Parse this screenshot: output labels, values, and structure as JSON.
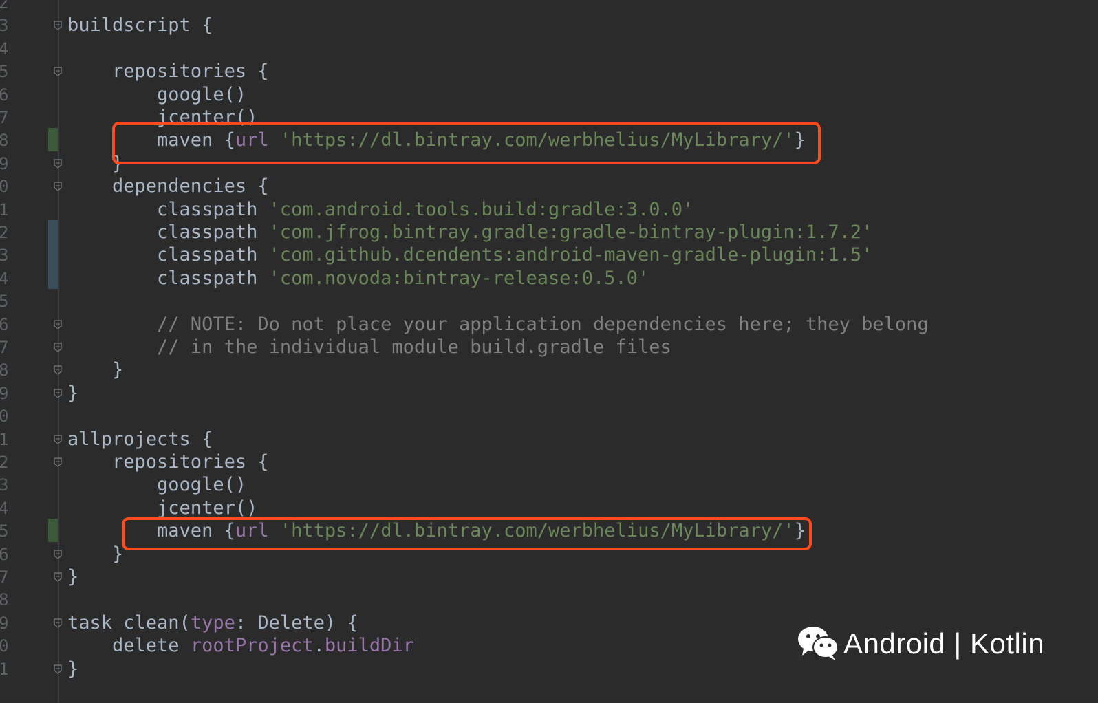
{
  "editor": {
    "lines": [
      {
        "n": "2",
        "code": ""
      },
      {
        "n": "3",
        "code": "buildscript {"
      },
      {
        "n": "4",
        "code": ""
      },
      {
        "n": "5",
        "code": "    repositories {"
      },
      {
        "n": "6",
        "code": "        google()"
      },
      {
        "n": "7",
        "code": "        jcenter()"
      },
      {
        "n": "8",
        "code": "        maven {",
        "prop": "url",
        "str": "'https://dl.bintray.com/werbhelius/MyLibrary/'",
        "tail": "}"
      },
      {
        "n": "9",
        "code": "    }"
      },
      {
        "n": "0",
        "code": "    dependencies {"
      },
      {
        "n": "1",
        "code": "        classpath ",
        "str": "'com.android.tools.build:gradle:3.0.0'"
      },
      {
        "n": "2",
        "code": "        classpath ",
        "str": "'com.jfrog.bintray.gradle:gradle-bintray-plugin:1.7.2'"
      },
      {
        "n": "3",
        "code": "        classpath ",
        "str": "'com.github.dcendents:android-maven-gradle-plugin:1.5'"
      },
      {
        "n": "4",
        "code": "        classpath ",
        "str": "'com.novoda:bintray-release:0.5.0'"
      },
      {
        "n": "5",
        "code": ""
      },
      {
        "n": "6",
        "cmt": "        // NOTE: Do not place your application dependencies here; they belong"
      },
      {
        "n": "7",
        "cmt": "        // in the individual module build.gradle files"
      },
      {
        "n": "8",
        "code": "    }"
      },
      {
        "n": "9",
        "code": "}"
      },
      {
        "n": "0",
        "code": ""
      },
      {
        "n": "1",
        "code": "allprojects {"
      },
      {
        "n": "2",
        "code": "    repositories {"
      },
      {
        "n": "3",
        "code": "        google()"
      },
      {
        "n": "4",
        "code": "        jcenter()"
      },
      {
        "n": "5",
        "code": "        maven {",
        "prop": "url",
        "str": "'https://dl.bintray.com/werbhelius/MyLibrary/'",
        "tail": "}"
      },
      {
        "n": "6",
        "code": "    }"
      },
      {
        "n": "7",
        "code": "}"
      },
      {
        "n": "8",
        "code": ""
      },
      {
        "n": "9",
        "code": "task clean(",
        "prop": "type",
        "tail2": ": Delete) {"
      },
      {
        "n": "0",
        "code": "    delete ",
        "prop": "rootProject",
        "tail": ".",
        "prop2": "buildDir"
      },
      {
        "n": "1",
        "code": "}"
      }
    ]
  },
  "watermark": {
    "icon": "wechat-icon",
    "text": "Android | Kotlin"
  },
  "colors": {
    "background": "#2b2b2b",
    "text": "#a9b7c6",
    "string": "#6a8759",
    "property": "#9876aa",
    "comment": "#808080",
    "highlight_box": "#ff4a1c"
  }
}
